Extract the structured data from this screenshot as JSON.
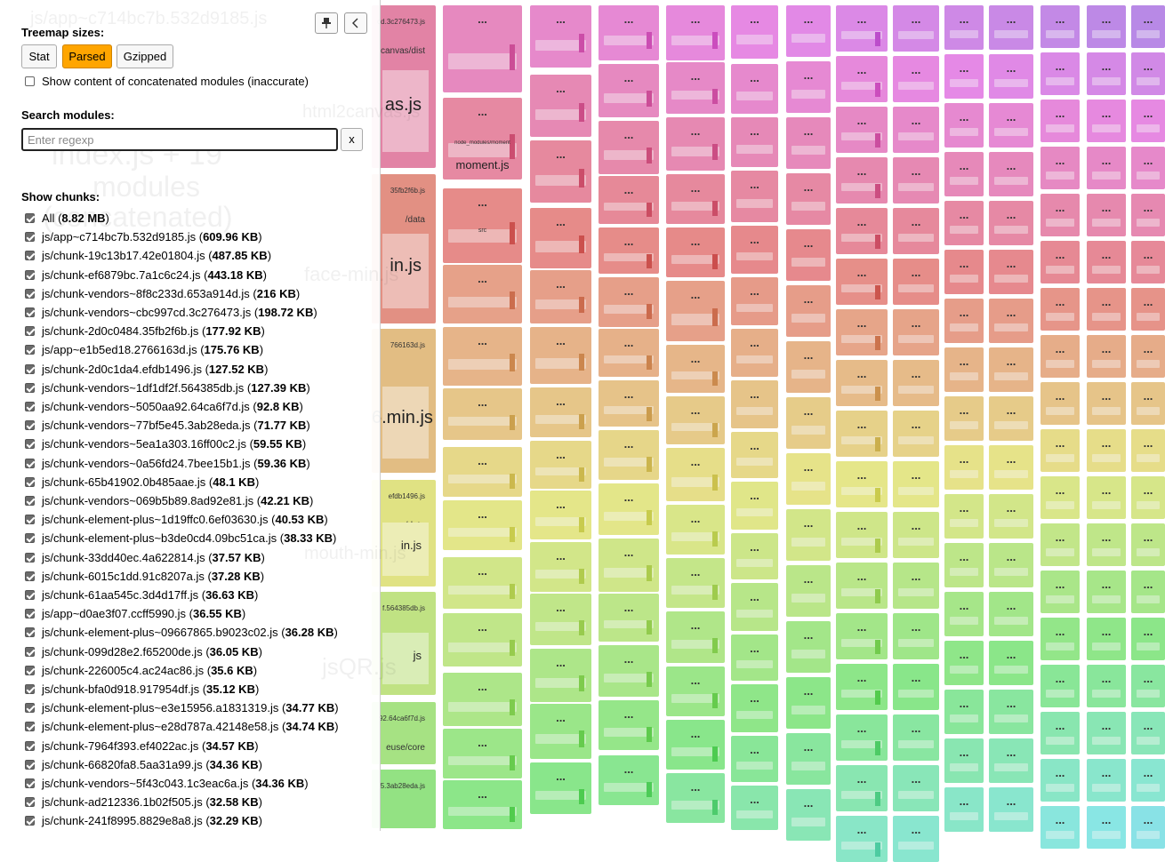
{
  "sidebar": {
    "treemap_sizes_label": "Treemap sizes:",
    "size_buttons": [
      "Stat",
      "Parsed",
      "Gzipped"
    ],
    "active_size": "Parsed",
    "concat_label": "Show content of concatenated modules (inaccurate)",
    "search_label": "Search modules:",
    "search_placeholder": "Enter regexp",
    "search_clear": "x",
    "show_chunks_label": "Show chunks:",
    "pin_icon": "pin-icon",
    "collapse_icon": "chevron-left-icon"
  },
  "chunks": [
    {
      "name": "All",
      "size": "8.82 MB"
    },
    {
      "name": "js/app~c714bc7b.532d9185.js",
      "size": "609.96 KB"
    },
    {
      "name": "js/chunk-19c13b17.42e01804.js",
      "size": "487.85 KB"
    },
    {
      "name": "js/chunk-ef6879bc.7a1c6c24.js",
      "size": "443.18 KB"
    },
    {
      "name": "js/chunk-vendors~8f8c233d.653a914d.js",
      "size": "216 KB"
    },
    {
      "name": "js/chunk-vendors~cbc997cd.3c276473.js",
      "size": "198.72 KB"
    },
    {
      "name": "js/chunk-2d0c0484.35fb2f6b.js",
      "size": "177.92 KB"
    },
    {
      "name": "js/app~e1b5ed18.2766163d.js",
      "size": "175.76 KB"
    },
    {
      "name": "js/chunk-2d0c1da4.efdb1496.js",
      "size": "127.52 KB"
    },
    {
      "name": "js/chunk-vendors~1df1df2f.564385db.js",
      "size": "127.39 KB"
    },
    {
      "name": "js/chunk-vendors~5050aa92.64ca6f7d.js",
      "size": "92.8 KB"
    },
    {
      "name": "js/chunk-vendors~77bf5e45.3ab28eda.js",
      "size": "71.77 KB"
    },
    {
      "name": "js/chunk-vendors~5ea1a303.16ff00c2.js",
      "size": "59.55 KB"
    },
    {
      "name": "js/chunk-vendors~0a56fd24.7bee15b1.js",
      "size": "59.36 KB"
    },
    {
      "name": "js/chunk-65b41902.0b485aae.js",
      "size": "48.1 KB"
    },
    {
      "name": "js/chunk-vendors~069b5b89.8ad92e81.js",
      "size": "42.21 KB"
    },
    {
      "name": "js/chunk-element-plus~1d19ffc0.6ef03630.js",
      "size": "40.53 KB"
    },
    {
      "name": "js/chunk-element-plus~b3de0cd4.09bc51ca.js",
      "size": "38.33 KB"
    },
    {
      "name": "js/chunk-33dd40ec.4a622814.js",
      "size": "37.57 KB"
    },
    {
      "name": "js/chunk-6015c1dd.91c8207a.js",
      "size": "37.28 KB"
    },
    {
      "name": "js/chunk-61aa545c.3d4d17ff.js",
      "size": "36.63 KB"
    },
    {
      "name": "js/app~d0ae3f07.ccff5990.js",
      "size": "36.55 KB"
    },
    {
      "name": "js/chunk-element-plus~09667865.b9023c02.js",
      "size": "36.28 KB"
    },
    {
      "name": "js/chunk-099d28e2.f65200de.js",
      "size": "36.05 KB"
    },
    {
      "name": "js/chunk-226005c4.ac24ac86.js",
      "size": "35.6 KB"
    },
    {
      "name": "js/chunk-bfa0d918.917954df.js",
      "size": "35.12 KB"
    },
    {
      "name": "js/chunk-element-plus~e3e15956.a1831319.js",
      "size": "34.77 KB"
    },
    {
      "name": "js/chunk-element-plus~e28d787a.42148e58.js",
      "size": "34.74 KB"
    },
    {
      "name": "js/chunk-7964f393.ef4022ac.js",
      "size": "34.57 KB"
    },
    {
      "name": "js/chunk-66820fa8.5aa31a99.js",
      "size": "34.36 KB"
    },
    {
      "name": "js/chunk-vendors~5f43c043.1c3eac6a.js",
      "size": "34.36 KB"
    },
    {
      "name": "js/chunk-ad212336.1b02f505.js",
      "size": "32.58 KB"
    },
    {
      "name": "js/chunk-241f8995.8829e8a8.js",
      "size": "32.29 KB"
    }
  ],
  "treemap": {
    "ghost_labels": [
      "js/app~c714bc7b.532d9185.js",
      "index.js + 19",
      "modules",
      "(concatenated)",
      "html2canvas.js",
      "face-min.js",
      "mouth-min.js",
      "jsQR.js"
    ],
    "col1_labels": [
      {
        "head": "cd.3c276473.js",
        "sub": "canvas/dist",
        "big": "as.js"
      },
      {
        "head": "35fb2f6b.js",
        "sub": "/data",
        "big": "in.js"
      },
      {
        "head": "766163d.js",
        "sub": "",
        "big": "6.min.js"
      },
      {
        "head": "efdb1496.js",
        "sub": "/data",
        "big": "in.js"
      },
      {
        "head": "f.564385db.js",
        "sub": "sqr/dist",
        "big": "js"
      },
      {
        "head": "92.64ca6f7d.js",
        "sub": "euse/core",
        "big": ""
      },
      {
        "head": "5.3ab28eda.js",
        "sub": "",
        "big": ""
      }
    ],
    "moment_label": "moment.js",
    "moment_path": "node_modules/moment",
    "src_label": "src",
    "dots": "..."
  }
}
